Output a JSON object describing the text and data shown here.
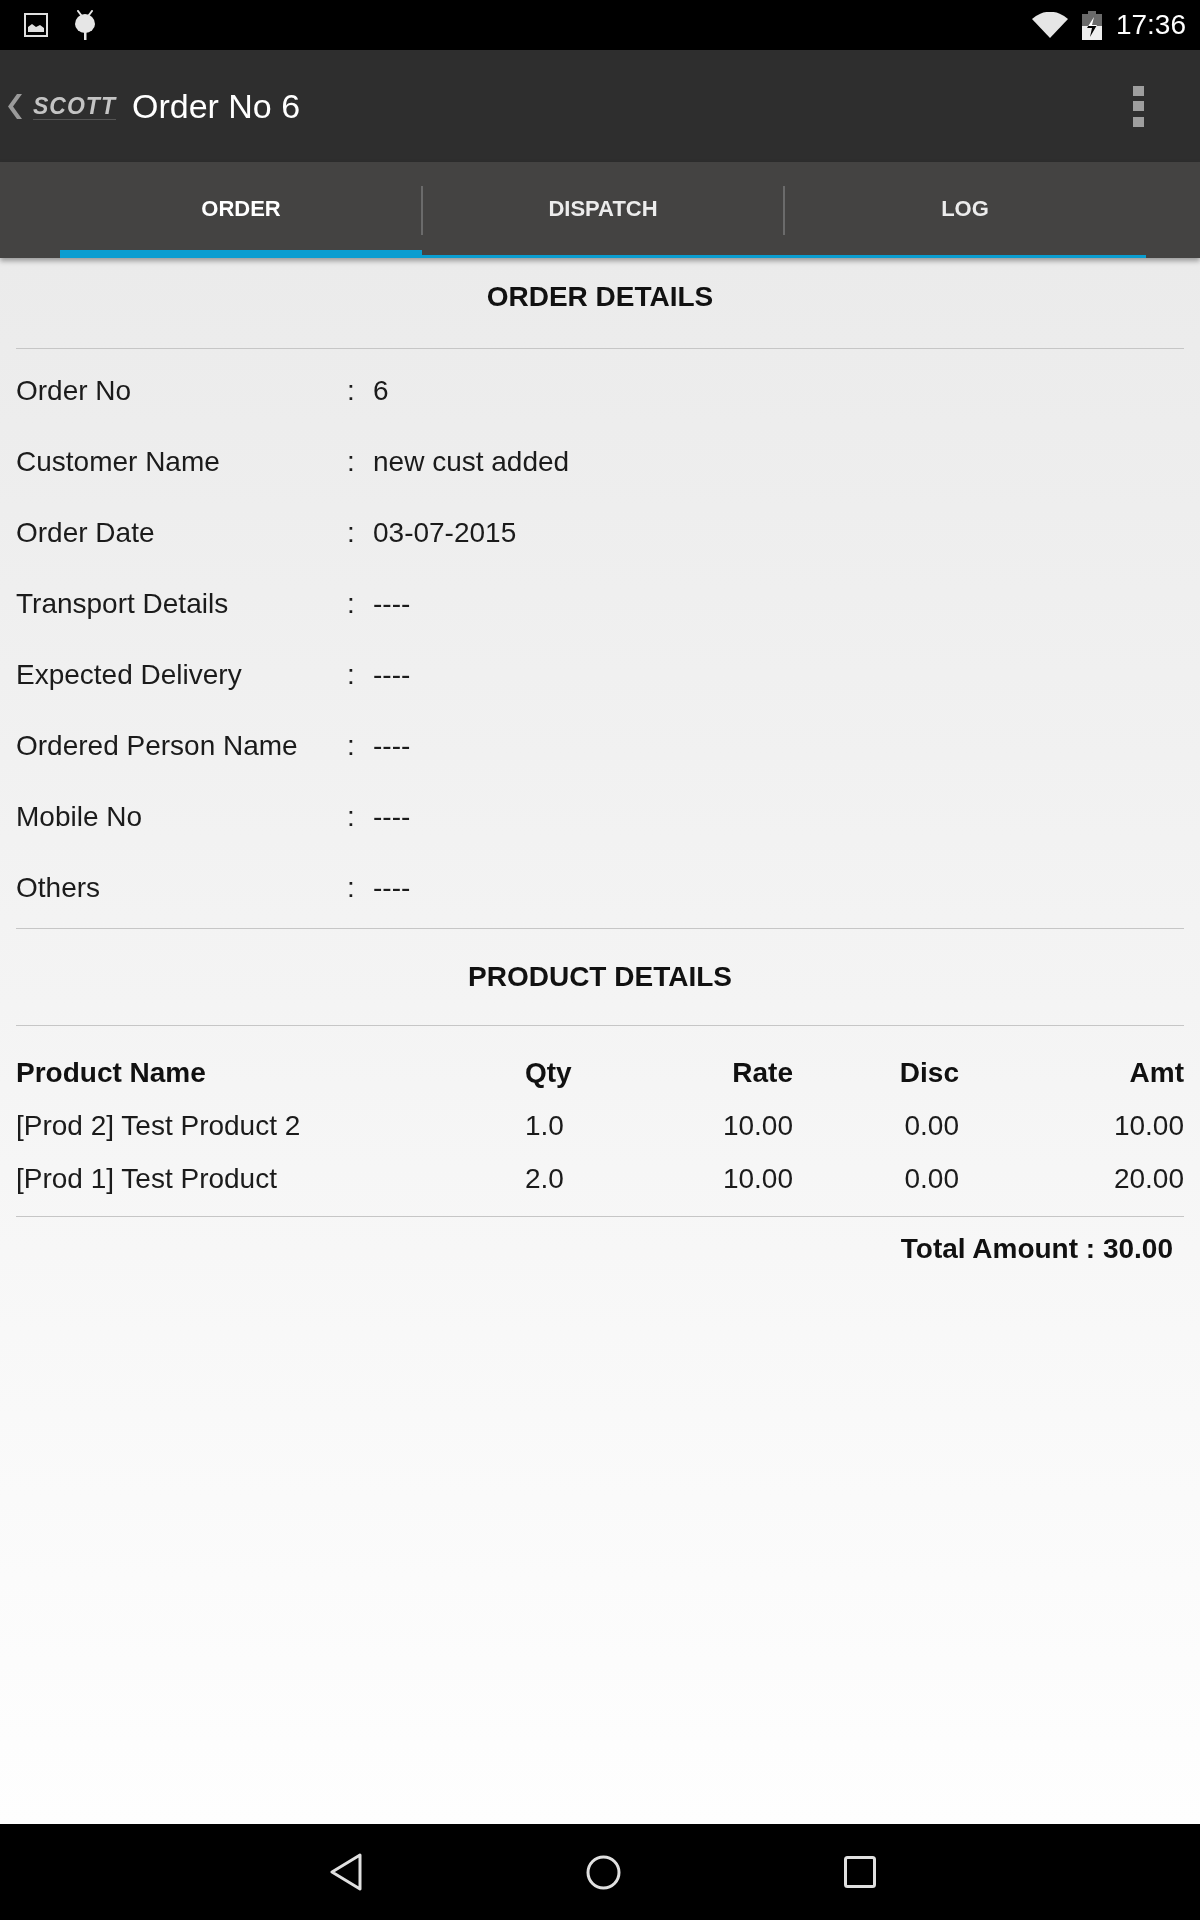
{
  "status_bar": {
    "time": "17:36"
  },
  "app_bar": {
    "logo": "SCOTT",
    "title": "Order No 6"
  },
  "tabs": [
    {
      "label": "ORDER",
      "selected": true
    },
    {
      "label": "DISPATCH",
      "selected": false
    },
    {
      "label": "LOG",
      "selected": false
    }
  ],
  "order_details": {
    "heading": "ORDER DETAILS",
    "fields": [
      {
        "label": "Order No",
        "separator": ":",
        "value": "6"
      },
      {
        "label": "Customer Name",
        "separator": ":",
        "value": "new cust added"
      },
      {
        "label": "Order Date",
        "separator": ":",
        "value": "03-07-2015"
      },
      {
        "label": "Transport Details",
        "separator": ":",
        "value": "----"
      },
      {
        "label": "Expected Delivery",
        "separator": ":",
        "value": "----"
      },
      {
        "label": "Ordered Person Name",
        "separator": ":",
        "value": "----"
      },
      {
        "label": "Mobile No",
        "separator": ":",
        "value": "----"
      },
      {
        "label": "Others",
        "separator": ":",
        "value": "----"
      }
    ]
  },
  "product_details": {
    "heading": "PRODUCT DETAILS",
    "columns": [
      "Product Name",
      "Qty",
      "Rate",
      "Disc",
      "Amt"
    ],
    "rows": [
      [
        "[Prod 2] Test Product 2",
        "1.0",
        "10.00",
        "0.00",
        "10.00"
      ],
      [
        "[Prod 1] Test Product",
        "2.0",
        "10.00",
        "0.00",
        "20.00"
      ]
    ],
    "total": "Total Amount : 30.00"
  }
}
